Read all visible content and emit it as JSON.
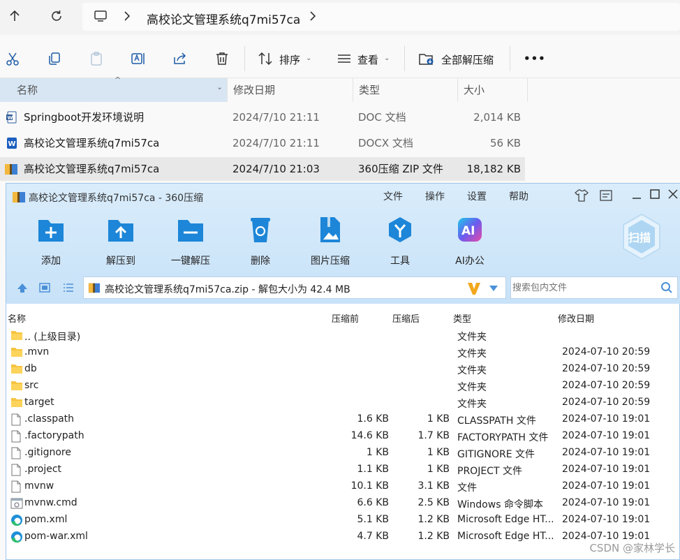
{
  "explorer": {
    "breadcrumb": "高校论文管理系统q7mi57ca",
    "toolbar": {
      "sort_label": "排序",
      "view_label": "查看",
      "extract_all_label": "全部解压缩",
      "more_label": "•••"
    },
    "columns": [
      "名称",
      "修改日期",
      "类型",
      "大小"
    ],
    "files": [
      {
        "name": "Springboot开发环境说明",
        "date": "2024/7/10 21:11",
        "type": "DOC 文档",
        "size": "2,014 KB"
      },
      {
        "name": "高校论文管理系统q7mi57ca",
        "date": "2024/7/10 21:11",
        "type": "DOCX 文档",
        "size": "56 KB"
      },
      {
        "name": "高校论文管理系统q7mi57ca",
        "date": "2024/7/10 21:03",
        "type": "360压缩 ZIP 文件",
        "size": "18,182 KB"
      }
    ]
  },
  "zipwin": {
    "title": "高校论文管理系统q7mi57ca - 360压缩",
    "menu": [
      "文件",
      "操作",
      "设置",
      "帮助"
    ],
    "tools": [
      "添加",
      "解压到",
      "一键解压",
      "删除",
      "图片压缩",
      "工具",
      "AI办公"
    ],
    "scan_label": "扫描",
    "path": "高校论文管理系统q7mi57ca.zip - 解包大小为 42.4 MB",
    "search_placeholder": "搜索包内文件",
    "columns": [
      "名称",
      "压缩前",
      "压缩后",
      "类型",
      "修改日期"
    ],
    "entries": [
      {
        "name": ".. (上级目录)",
        "before": "",
        "after": "",
        "type": "文件夹",
        "date": "",
        "icon": "folder-icon"
      },
      {
        "name": ".mvn",
        "before": "",
        "after": "",
        "type": "文件夹",
        "date": "2024-07-10 20:59",
        "icon": "folder-icon"
      },
      {
        "name": "db",
        "before": "",
        "after": "",
        "type": "文件夹",
        "date": "2024-07-10 20:59",
        "icon": "folder-icon"
      },
      {
        "name": "src",
        "before": "",
        "after": "",
        "type": "文件夹",
        "date": "2024-07-10 20:59",
        "icon": "folder-icon"
      },
      {
        "name": "target",
        "before": "",
        "after": "",
        "type": "文件夹",
        "date": "2024-07-10 20:59",
        "icon": "folder-icon"
      },
      {
        "name": ".classpath",
        "before": "1.6 KB",
        "after": "1 KB",
        "type": "CLASSPATH 文件",
        "date": "2024-07-10 19:01",
        "icon": "file-icon"
      },
      {
        "name": ".factorypath",
        "before": "14.6 KB",
        "after": "1.7 KB",
        "type": "FACTORYPATH 文件",
        "date": "2024-07-10 19:01",
        "icon": "file-icon"
      },
      {
        "name": ".gitignore",
        "before": "1 KB",
        "after": "1 KB",
        "type": "GITIGNORE 文件",
        "date": "2024-07-10 19:01",
        "icon": "file-icon"
      },
      {
        "name": ".project",
        "before": "1.1 KB",
        "after": "1 KB",
        "type": "PROJECT 文件",
        "date": "2024-07-10 19:01",
        "icon": "file-icon"
      },
      {
        "name": "mvnw",
        "before": "10.1 KB",
        "after": "3.1 KB",
        "type": "文件",
        "date": "2024-07-10 19:01",
        "icon": "file-icon"
      },
      {
        "name": "mvnw.cmd",
        "before": "6.6 KB",
        "after": "2.5 KB",
        "type": "Windows 命令脚本",
        "date": "2024-07-10 19:01",
        "icon": "cmd-icon"
      },
      {
        "name": "pom.xml",
        "before": "5.1 KB",
        "after": "1.2 KB",
        "type": "Microsoft Edge HT...",
        "date": "2024-07-10 19:01",
        "icon": "edge-icon"
      },
      {
        "name": "pom-war.xml",
        "before": "4.7 KB",
        "after": "1.2 KB",
        "type": "Microsoft Edge HT...",
        "date": "2024-07-10 19:01",
        "icon": "edge-icon"
      }
    ]
  },
  "watermark": "CSDN @家林学长"
}
